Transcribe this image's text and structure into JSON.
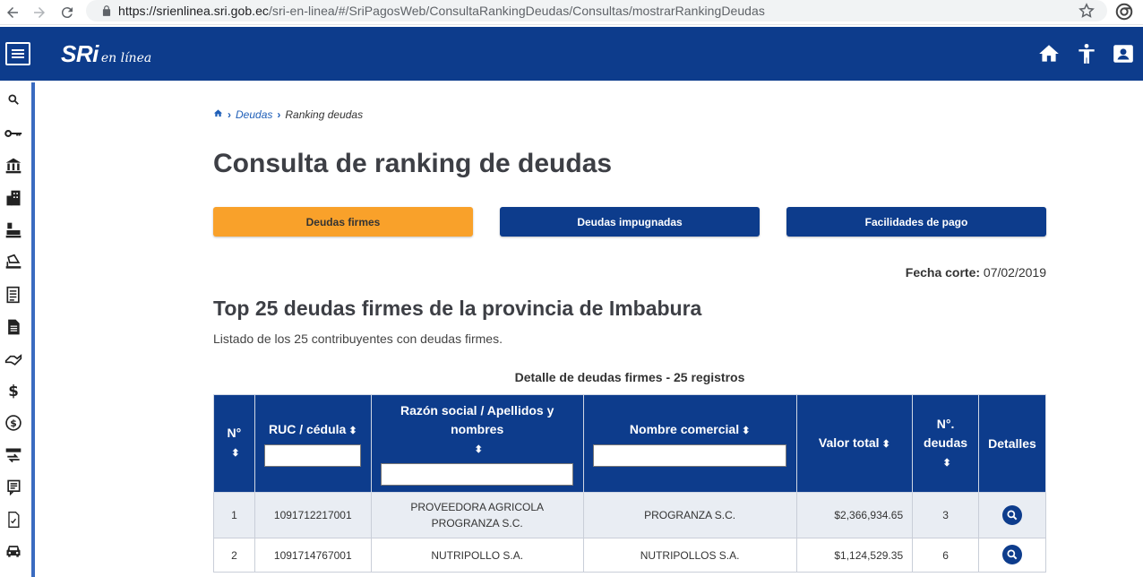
{
  "browser": {
    "url_host": "https://srienlinea.sri.gob.ec",
    "url_path": "/sri-en-linea/#/SriPagosWeb/ConsultaRankingDeudas/Consultas/mostrarRankingDeudas"
  },
  "header": {
    "logo_main": "SRi",
    "logo_sub": "en línea"
  },
  "breadcrumb": {
    "items": [
      "Deudas",
      "Ranking deudas"
    ]
  },
  "page_title": "Consulta de ranking de deudas",
  "tabs": [
    {
      "label": "Deudas firmes",
      "active": true
    },
    {
      "label": "Deudas impugnadas",
      "active": false
    },
    {
      "label": "Facilidades de pago",
      "active": false
    }
  ],
  "fecha": {
    "label": "Fecha corte:",
    "value": "07/02/2019"
  },
  "section": {
    "title": "Top 25 deudas firmes de la provincia de Imbabura",
    "subtitle": "Listado de los 25 contribuyentes con deudas firmes."
  },
  "table": {
    "caption": "Detalle de deudas firmes - 25 registros",
    "headers": {
      "num": "N°",
      "ruc": "RUC / cédula",
      "razon": "Razón social / Apellidos y nombres",
      "nombre": "Nombre comercial",
      "valor": "Valor total",
      "ndeudas": "N°. deudas",
      "detalles": "Detalles"
    },
    "rows": [
      {
        "num": "1",
        "ruc": "1091712217001",
        "razon": "PROVEEDORA AGRICOLA PROGRANZA S.C.",
        "nombre": "PROGRANZA S.C.",
        "valor": "$2,366,934.65",
        "ndeudas": "3"
      },
      {
        "num": "2",
        "ruc": "1091714767001",
        "razon": "NUTRIPOLLO S.A.",
        "nombre": "NUTRIPOLLOS S.A.",
        "valor": "$1,124,529.35",
        "ndeudas": "6"
      }
    ]
  },
  "colors": {
    "brand_blue": "#0d3c8c",
    "active_tab": "#f9a12a"
  },
  "icons": {
    "sidebar": [
      "search-icon",
      "key-icon",
      "bank-icon",
      "buildings-icon",
      "cashier-icon",
      "laptop-icon",
      "document-list-icon",
      "document-icon",
      "handshake-icon",
      "dollar-icon",
      "coin-icon",
      "transfer-icon",
      "receipt-icon",
      "checklist-icon",
      "car-icon"
    ],
    "header": [
      "home-icon",
      "accessibility-icon",
      "user-icon"
    ]
  }
}
